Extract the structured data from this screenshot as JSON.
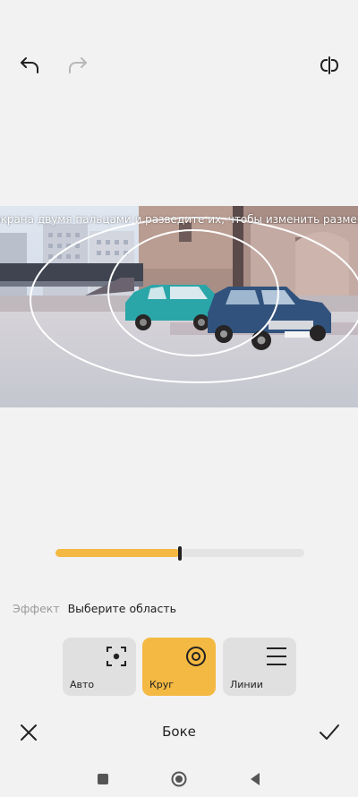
{
  "toolbar": {
    "undo_icon": "undo-icon",
    "redo_icon": "redo-icon",
    "compare_icon": "compare-icon"
  },
  "photo": {
    "hint_text": "экрана двумя пальцами и разведите их, чтобы изменить размер выбран"
  },
  "slider": {
    "value_fraction": 0.5,
    "fill_color": "#f4b942"
  },
  "effect": {
    "label": "Эффект",
    "value": "Выберите область"
  },
  "modes": [
    {
      "label": "Авто",
      "icon": "focus-auto-icon",
      "selected": false
    },
    {
      "label": "Круг",
      "icon": "circle-target-icon",
      "selected": true
    },
    {
      "label": "Линии",
      "icon": "lines-icon",
      "selected": false
    }
  ],
  "bottom_bar": {
    "title": "Боке",
    "cancel_icon": "close-icon",
    "confirm_icon": "check-icon"
  },
  "navigation": {
    "recents_icon": "square-icon",
    "home_icon": "circle-icon",
    "back_icon": "triangle-back-icon"
  },
  "colors": {
    "accent": "#f4b942",
    "background": "#f2f2f2"
  }
}
